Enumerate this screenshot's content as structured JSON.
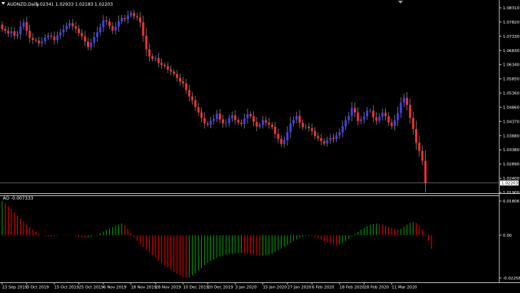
{
  "chart_window": {
    "menu_icon": "triangle-down-icon",
    "shift_marker_icon": "triangle-down-icon"
  },
  "colors": {
    "background": "#000000",
    "frame": "#c8c8c8",
    "bull_candle": "#4040ff",
    "bear_candle": "#ff3030",
    "wick": "#8c8c8c",
    "ao_up": "#00b000",
    "ao_down": "#ff0000",
    "label_text": "#ffffff",
    "price_line": "#9a9a9a",
    "price_tag_bg": "#ffffff",
    "price_tag_text": "#000000"
  },
  "chart_data": [
    {
      "type": "candlestick",
      "title": "AUDNZD,Daily",
      "ohlc_label": "1.02341 1.02933 1.02183 1.02203",
      "ylim": [
        1.019,
        1.083
      ],
      "y_ticks": [
        "1.08310",
        "1.07820",
        "1.07330",
        "1.06830",
        "1.06340",
        "1.05850",
        "1.05360",
        "1.04860",
        "1.04370",
        "1.03880",
        "1.03380",
        "1.02890",
        "1.02400",
        "1.01900"
      ],
      "last_price": "1.02203",
      "closes": [
        1.0752,
        1.0746,
        1.0737,
        1.0744,
        1.0728,
        1.0734,
        1.076,
        1.0775,
        1.0746,
        1.0721,
        1.0714,
        1.0712,
        1.0703,
        1.0709,
        1.0723,
        1.0729,
        1.0726,
        1.0714,
        1.073,
        1.074,
        1.0751,
        1.0764,
        1.0772,
        1.0761,
        1.0753,
        1.0738,
        1.0727,
        1.0709,
        1.069,
        1.0705,
        1.0724,
        1.0741,
        1.0758,
        1.0782,
        1.0778,
        1.0762,
        1.0747,
        1.076,
        1.0779,
        1.079,
        1.0786,
        1.0799,
        1.0807,
        1.0796,
        1.0792,
        1.0775,
        1.0729,
        1.0682,
        1.0658,
        1.0649,
        1.0652,
        1.0635,
        1.0628,
        1.0624,
        1.0612,
        1.0605,
        1.0597,
        1.0583,
        1.0571,
        1.0564,
        1.0541,
        1.0519,
        1.0506,
        1.0482,
        1.0464,
        1.0445,
        1.0426,
        1.0422,
        1.0435,
        1.0441,
        1.046,
        1.044,
        1.0426,
        1.0427,
        1.0444,
        1.0454,
        1.0438,
        1.0429,
        1.0424,
        1.0443,
        1.0458,
        1.0451,
        1.0431,
        1.0415,
        1.0421,
        1.0437,
        1.0429,
        1.0422,
        1.0414,
        1.039,
        1.0373,
        1.0355,
        1.0368,
        1.0396,
        1.0426,
        1.0439,
        1.0452,
        1.0428,
        1.0413,
        1.0415,
        1.0409,
        1.04,
        1.0383,
        1.0375,
        1.0365,
        1.0357,
        1.0368,
        1.0376,
        1.0372,
        1.0385,
        1.0395,
        1.0416,
        1.0437,
        1.0452,
        1.0479,
        1.0464,
        1.0434,
        1.044,
        1.045,
        1.047,
        1.047,
        1.0447,
        1.0436,
        1.0449,
        1.0463,
        1.0451,
        1.0429,
        1.0417,
        1.0437,
        1.0462,
        1.0497,
        1.0514,
        1.049,
        1.0445,
        1.0407,
        1.0359,
        1.0331,
        1.0297,
        1.022
      ]
    },
    {
      "type": "bar",
      "title": "AO -0.007333",
      "ylim": [
        -0.02258,
        0.01806
      ],
      "y_ticks": [
        "0.01806",
        "0.00",
        "-0.02258"
      ],
      "values": [
        0.0182,
        0.017,
        0.0154,
        0.0138,
        0.0121,
        0.0104,
        0.0087,
        0.0072,
        0.0057,
        0.0043,
        0.003,
        0.0019,
        0.0009,
        0.0,
        -0.0005,
        -0.0007,
        -0.0006,
        -0.0004,
        -0.0002,
        0.0,
        0.0001,
        0.0002,
        0.0001,
        0.0,
        -0.0004,
        -0.001,
        -0.0013,
        -0.0015,
        -0.0013,
        -0.0008,
        -0.0002,
        0.0004,
        0.0011,
        0.0019,
        0.0028,
        0.0036,
        0.0044,
        0.0051,
        0.0058,
        0.0062,
        0.0055,
        0.0032,
        0.001,
        -0.001,
        -0.0029,
        -0.0046,
        -0.0062,
        -0.0077,
        -0.009,
        -0.0104,
        -0.0118,
        -0.0132,
        -0.0145,
        -0.0158,
        -0.017,
        -0.0182,
        -0.0193,
        -0.0203,
        -0.0212,
        -0.022,
        -0.0226,
        -0.0222,
        -0.0212,
        -0.02,
        -0.0186,
        -0.0172,
        -0.0158,
        -0.0146,
        -0.0136,
        -0.0128,
        -0.012,
        -0.0114,
        -0.0108,
        -0.0104,
        -0.01,
        -0.0098,
        -0.0096,
        -0.0095,
        -0.0095,
        -0.0096,
        -0.0098,
        -0.0101,
        -0.0104,
        -0.0106,
        -0.0108,
        -0.0108,
        -0.0106,
        -0.0102,
        -0.0096,
        -0.0088,
        -0.0079,
        -0.007,
        -0.006,
        -0.005,
        -0.004,
        -0.003,
        -0.0021,
        -0.0014,
        -0.0008,
        -0.0004,
        -0.0002,
        -0.0004,
        -0.0009,
        -0.0015,
        -0.0022,
        -0.003,
        -0.0038,
        -0.0045,
        -0.0051,
        -0.0052,
        -0.0048,
        -0.004,
        -0.003,
        -0.0018,
        -0.0006,
        0.0006,
        0.0018,
        0.003,
        0.004,
        0.0048,
        0.0056,
        0.006,
        0.0062,
        0.006,
        0.0056,
        0.005,
        0.0044,
        0.0038,
        0.0032,
        0.003,
        0.0034,
        0.0044,
        0.0056,
        0.0066,
        0.007,
        0.0064,
        0.005,
        0.003,
        0.0004,
        -0.003,
        -0.0073
      ]
    }
  ],
  "time_axis": {
    "labels": [
      "23 Sep 2019",
      "3 Oct 2019",
      "15 Oct 2019",
      "25 Oct 2019",
      "6 Nov 2019",
      "18 Nov 2019",
      "28 Nov 2019",
      "10 Dec 2019",
      "20 Dec 2019",
      "3 Jan 2020",
      "15 Jan 2020",
      "27 Jan 2020",
      "6 Feb 2020",
      "18 Feb 2020",
      "28 Feb 2020",
      "11 Mar 2020"
    ],
    "bar_index": [
      0,
      8,
      17,
      25,
      33,
      42,
      50,
      59,
      67,
      76,
      85,
      93,
      101,
      110,
      118,
      127
    ]
  }
}
